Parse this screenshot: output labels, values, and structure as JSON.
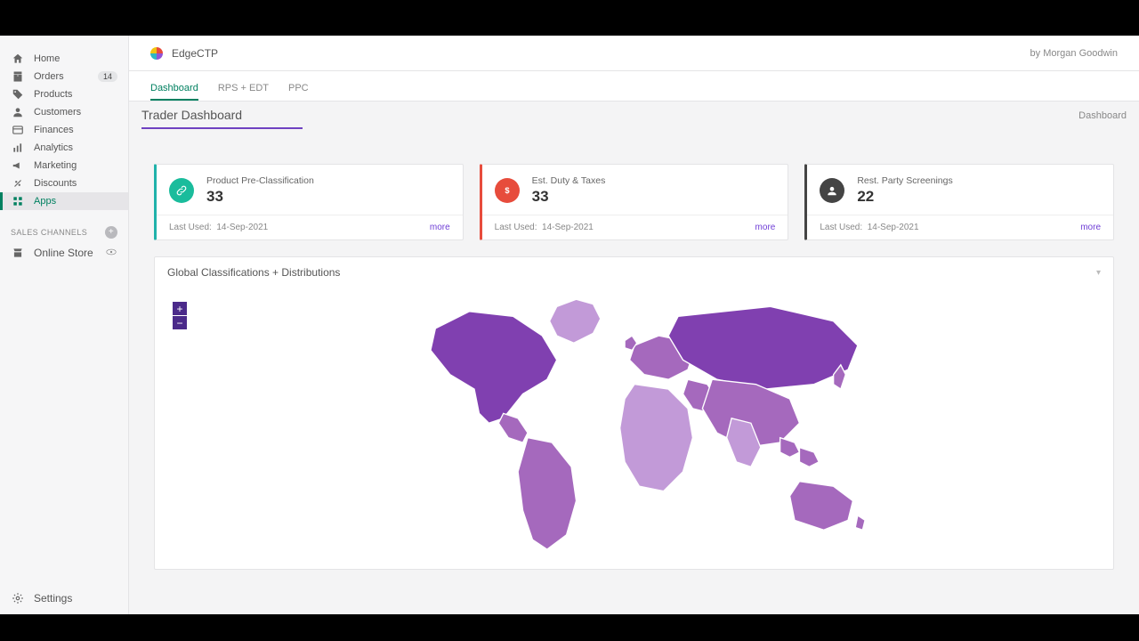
{
  "sidebar": {
    "items": [
      {
        "label": "Home",
        "icon": "home-icon"
      },
      {
        "label": "Orders",
        "icon": "orders-icon",
        "badge": "14"
      },
      {
        "label": "Products",
        "icon": "tag-icon"
      },
      {
        "label": "Customers",
        "icon": "person-icon"
      },
      {
        "label": "Finances",
        "icon": "finance-icon"
      },
      {
        "label": "Analytics",
        "icon": "chart-icon"
      },
      {
        "label": "Marketing",
        "icon": "megaphone-icon"
      },
      {
        "label": "Discounts",
        "icon": "discount-icon"
      },
      {
        "label": "Apps",
        "icon": "apps-icon",
        "active": true
      }
    ],
    "channels_header": "SALES CHANNELS",
    "channels": [
      {
        "label": "Online Store",
        "icon": "store-icon"
      }
    ],
    "settings_label": "Settings"
  },
  "header": {
    "app_name": "EdgeCTP",
    "byline": "by Morgan Goodwin"
  },
  "tabs": [
    {
      "label": "Dashboard",
      "active": true
    },
    {
      "label": "RPS + EDT"
    },
    {
      "label": "PPC"
    }
  ],
  "page": {
    "title": "Trader Dashboard",
    "breadcrumb": "Dashboard"
  },
  "cards": [
    {
      "title": "Product Pre-Classification",
      "value": "33",
      "last_used_label": "Last Used:",
      "last_used": "14-Sep-2021",
      "more": "more",
      "accent": "teal",
      "icon": "link-icon"
    },
    {
      "title": "Est. Duty & Taxes",
      "value": "33",
      "last_used_label": "Last Used:",
      "last_used": "14-Sep-2021",
      "more": "more",
      "accent": "red",
      "icon": "dollar-icon"
    },
    {
      "title": "Rest. Party Screenings",
      "value": "22",
      "last_used_label": "Last Used:",
      "last_used": "14-Sep-2021",
      "more": "more",
      "accent": "dark",
      "icon": "avatar-icon"
    }
  ],
  "map": {
    "title": "Global Classifications + Distributions",
    "zoom_in": "+",
    "zoom_out": "−"
  }
}
